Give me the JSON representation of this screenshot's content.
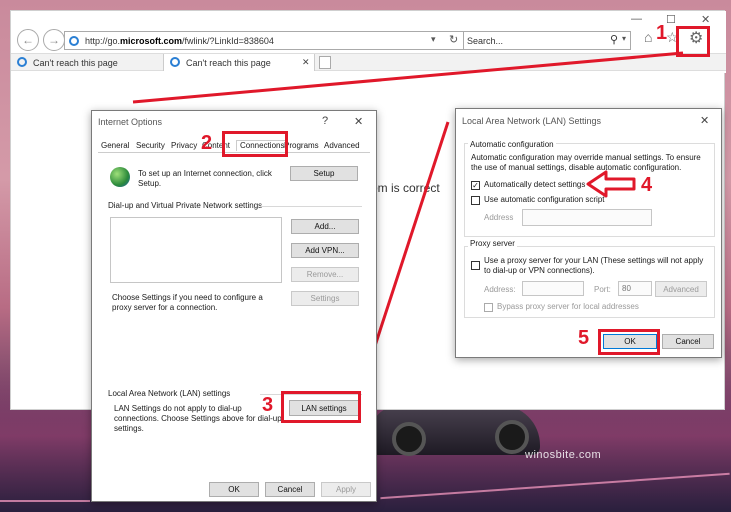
{
  "browser": {
    "address": "http://go.microsoft.com/fwlink/?LinkId=838604",
    "address_host_plain": "http://go.",
    "address_host_bold": "microsoft.com",
    "address_rest": "/fwlink/?LinkId=838604",
    "search_placeholder": "Search...",
    "tabs": [
      "Can't reach this page",
      "Can't reach this page"
    ],
    "page_text_fragment": "om is correct"
  },
  "internet_options": {
    "title": "Internet Options",
    "help": "?",
    "tabs": [
      "General",
      "Security",
      "Privacy",
      "Content",
      "Connections",
      "Programs",
      "Advanced"
    ],
    "setup_text": "To set up an Internet connection, click Setup.",
    "setup_button": "Setup",
    "dialup_group": "Dial-up and Virtual Private Network settings",
    "add_button": "Add...",
    "add_vpn_button": "Add VPN...",
    "remove_button": "Remove...",
    "settings_text": "Choose Settings if you need to configure a proxy server for a connection.",
    "settings_button": "Settings",
    "lan_group": "Local Area Network (LAN) settings",
    "lan_text": "LAN Settings do not apply to dial-up connections. Choose Settings above for dial-up settings.",
    "lan_button": "LAN settings",
    "ok": "OK",
    "cancel": "Cancel",
    "apply": "Apply"
  },
  "lan_dialog": {
    "title": "Local Area Network (LAN) Settings",
    "auto_group": "Automatic configuration",
    "auto_desc": "Automatic configuration may override manual settings.  To ensure the use of manual settings, disable automatic configuration.",
    "auto_detect": "Automatically detect settings",
    "auto_detect_checked": true,
    "auto_script": "Use automatic configuration script",
    "address_label": "Address",
    "proxy_group": "Proxy server",
    "proxy_use": "Use a proxy server for your LAN (These settings will not apply to dial-up or VPN connections).",
    "proxy_address_label": "Address:",
    "proxy_port_label": "Port:",
    "proxy_port_value": "80",
    "advanced_button": "Advanced",
    "bypass": "Bypass proxy server for local addresses",
    "ok": "OK",
    "cancel": "Cancel"
  },
  "annotations": {
    "step1": "1",
    "step2": "2",
    "step3": "3",
    "step4": "4",
    "step5": "5",
    "color": "#e0182a"
  },
  "watermark": "winosbite.com"
}
